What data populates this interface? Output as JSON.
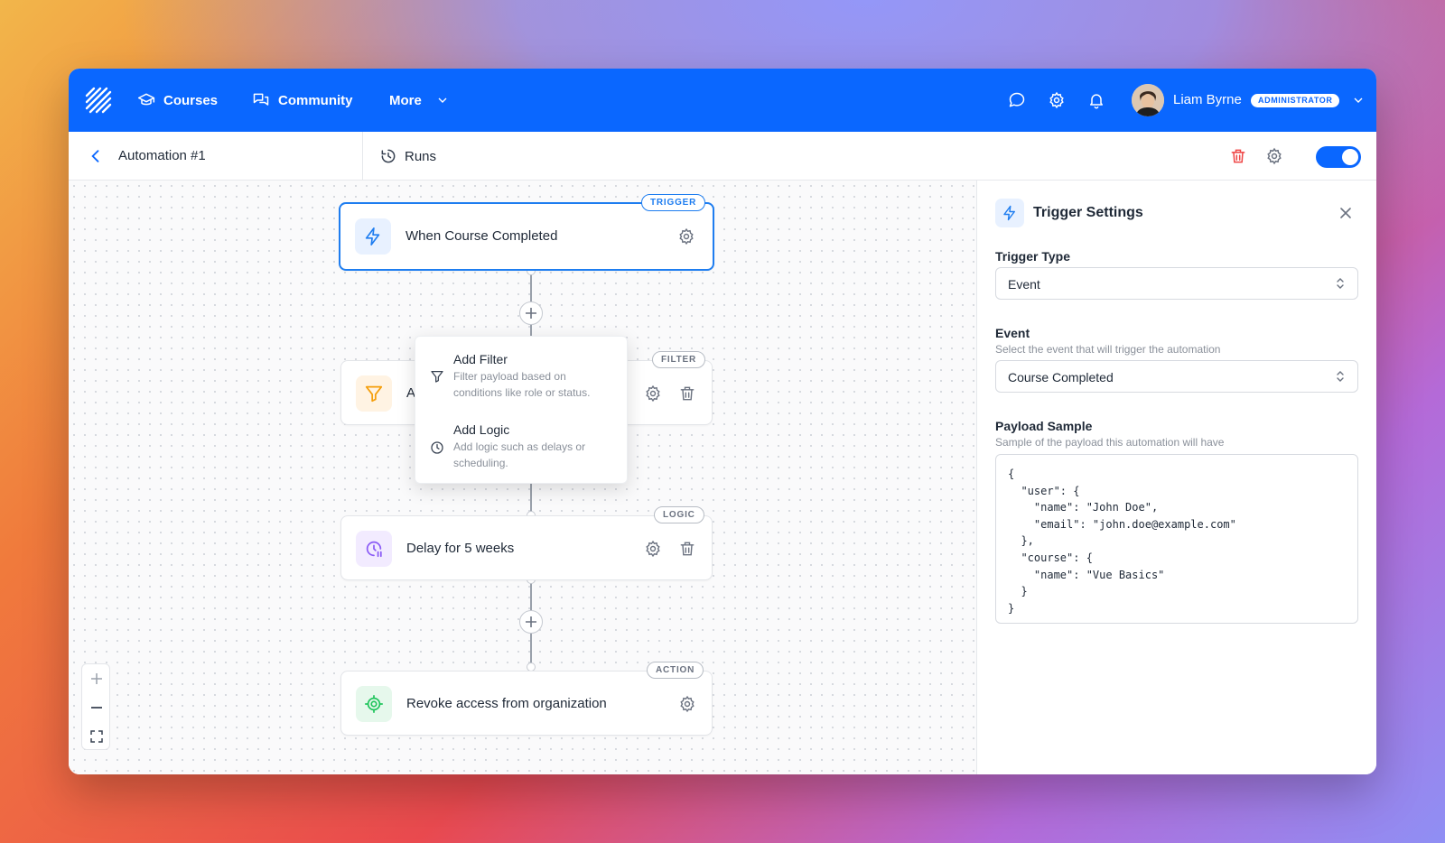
{
  "nav": {
    "courses": "Courses",
    "community": "Community",
    "more": "More",
    "user_name": "Liam Byrne",
    "role": "ADMINISTRATOR"
  },
  "subbar": {
    "title": "Automation #1",
    "runs": "Runs",
    "enabled": true
  },
  "flow": {
    "nodes": [
      {
        "tag": "TRIGGER",
        "label": "When Course Completed",
        "icon": "bolt-icon"
      },
      {
        "tag": "FILTER",
        "label": "Ac",
        "icon": "funnel-icon"
      },
      {
        "tag": "LOGIC",
        "label": "Delay for 5 weeks",
        "icon": "clock-pause-icon"
      },
      {
        "tag": "ACTION",
        "label": "Revoke access from organization",
        "icon": "target-icon"
      }
    ],
    "popover": {
      "items": [
        {
          "title": "Add Filter",
          "desc": "Filter payload based on conditions like role or status."
        },
        {
          "title": "Add Logic",
          "desc": "Add logic such as delays or scheduling."
        }
      ]
    }
  },
  "panel": {
    "title": "Trigger Settings",
    "trigger_type_label": "Trigger Type",
    "trigger_type_value": "Event",
    "event_label": "Event",
    "event_help": "Select the event that will trigger the automation",
    "event_value": "Course Completed",
    "payload_label": "Payload Sample",
    "payload_help": "Sample of the payload this automation will have",
    "payload": "{\n  \"user\": {\n    \"name\": \"John Doe\",\n    \"email\": \"john.doe@example.com\"\n  },\n  \"course\": {\n    \"name\": \"Vue Basics\"\n  }\n}"
  },
  "colors": {
    "brand": "#0a67ff",
    "trigger": "#1e7df0",
    "filter": "#f59e0b",
    "logic": "#8b5cf6",
    "action": "#22c55e",
    "danger": "#ef4444"
  }
}
